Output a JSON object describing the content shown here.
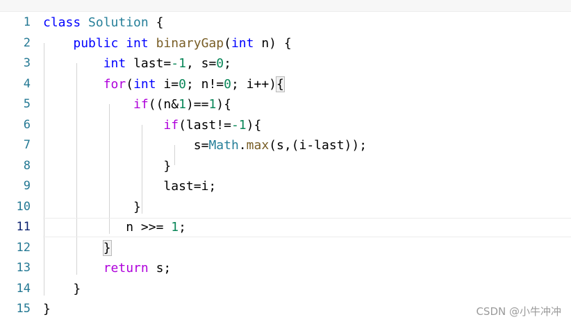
{
  "editor": {
    "lines": [
      {
        "n": "1",
        "tokens": [
          {
            "t": "class ",
            "c": "kw"
          },
          {
            "t": "Solution",
            "c": "ty"
          },
          {
            "t": " {",
            "c": ""
          }
        ]
      },
      {
        "n": "2",
        "tokens": [
          {
            "t": "    ",
            "c": ""
          },
          {
            "t": "public ",
            "c": "kw"
          },
          {
            "t": "int ",
            "c": "kw"
          },
          {
            "t": "binaryGap",
            "c": "fn"
          },
          {
            "t": "(",
            "c": ""
          },
          {
            "t": "int ",
            "c": "kw"
          },
          {
            "t": "n) {",
            "c": ""
          }
        ]
      },
      {
        "n": "3",
        "tokens": [
          {
            "t": "        ",
            "c": ""
          },
          {
            "t": "int ",
            "c": "kw"
          },
          {
            "t": "last=",
            "c": ""
          },
          {
            "t": "-1",
            "c": "num"
          },
          {
            "t": ", s=",
            "c": ""
          },
          {
            "t": "0",
            "c": "num"
          },
          {
            "t": ";",
            "c": ""
          }
        ]
      },
      {
        "n": "4",
        "tokens": [
          {
            "t": "        ",
            "c": ""
          },
          {
            "t": "for",
            "c": "ctl"
          },
          {
            "t": "(",
            "c": ""
          },
          {
            "t": "int ",
            "c": "kw"
          },
          {
            "t": "i=",
            "c": ""
          },
          {
            "t": "0",
            "c": "num"
          },
          {
            "t": "; n!=",
            "c": ""
          },
          {
            "t": "0",
            "c": "num"
          },
          {
            "t": "; i++)",
            "c": ""
          },
          {
            "t": "{",
            "c": "bmatch"
          }
        ]
      },
      {
        "n": "5",
        "tokens": [
          {
            "t": "            ",
            "c": ""
          },
          {
            "t": "if",
            "c": "ctl"
          },
          {
            "t": "((n&",
            "c": ""
          },
          {
            "t": "1",
            "c": "num"
          },
          {
            "t": ")==",
            "c": ""
          },
          {
            "t": "1",
            "c": "num"
          },
          {
            "t": "){",
            "c": ""
          }
        ]
      },
      {
        "n": "6",
        "tokens": [
          {
            "t": "                ",
            "c": ""
          },
          {
            "t": "if",
            "c": "ctl"
          },
          {
            "t": "(last!=",
            "c": ""
          },
          {
            "t": "-1",
            "c": "num"
          },
          {
            "t": "){",
            "c": ""
          }
        ]
      },
      {
        "n": "7",
        "tokens": [
          {
            "t": "                    ",
            "c": ""
          },
          {
            "t": "s=",
            "c": ""
          },
          {
            "t": "Math",
            "c": "ty"
          },
          {
            "t": ".",
            "c": ""
          },
          {
            "t": "max",
            "c": "fn"
          },
          {
            "t": "(s,(i-last));",
            "c": ""
          }
        ]
      },
      {
        "n": "8",
        "tokens": [
          {
            "t": "                ",
            "c": ""
          },
          {
            "t": "}",
            "c": ""
          }
        ]
      },
      {
        "n": "9",
        "tokens": [
          {
            "t": "                ",
            "c": ""
          },
          {
            "t": "last=i;",
            "c": ""
          }
        ]
      },
      {
        "n": "10",
        "tokens": [
          {
            "t": "            ",
            "c": ""
          },
          {
            "t": "}",
            "c": ""
          }
        ]
      },
      {
        "n": "11",
        "current": true,
        "tokens": [
          {
            "t": "           ",
            "c": ""
          },
          {
            "t": "n >>= ",
            "c": ""
          },
          {
            "t": "1",
            "c": "num"
          },
          {
            "t": ";",
            "c": ""
          }
        ]
      },
      {
        "n": "12",
        "tokens": [
          {
            "t": "        ",
            "c": ""
          },
          {
            "t": "}",
            "c": "bmatch"
          }
        ]
      },
      {
        "n": "13",
        "tokens": [
          {
            "t": "        ",
            "c": ""
          },
          {
            "t": "return ",
            "c": "ctl"
          },
          {
            "t": "s;",
            "c": ""
          }
        ]
      },
      {
        "n": "14",
        "tokens": [
          {
            "t": "    ",
            "c": ""
          },
          {
            "t": "}",
            "c": ""
          }
        ]
      },
      {
        "n": "15",
        "tokens": [
          {
            "t": "}",
            "c": ""
          }
        ]
      }
    ]
  },
  "watermark": "CSDN @小牛冲冲"
}
